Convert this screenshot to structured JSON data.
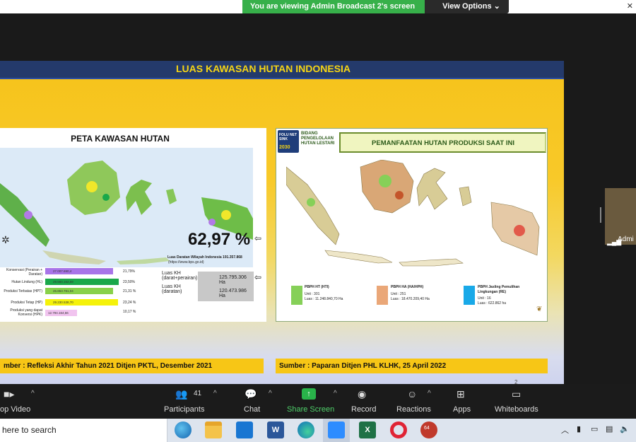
{
  "zoom_banner": {
    "viewing_text": "You are viewing Admin Broadcast 2's screen",
    "view_options_label": "View Options"
  },
  "slide": {
    "title": "LUAS KAWASAN HUTAN INDONESIA",
    "page_number": "2",
    "left_panel": {
      "map_title": "PETA KAWASAN HUTAN",
      "percentage": "62,97 %",
      "land_area_note": "Luas Daratan Wilayah Indonesia 191.357.868",
      "land_area_source": "(https://www.bps.go.id)",
      "legend": [
        {
          "label": "Konservasi (Perairan + Daratan)",
          "value": "27.007.690,4",
          "pct": "21,79%",
          "color": "#a874e8",
          "fill": 0.78
        },
        {
          "label": "Hutan Lindung (HL)",
          "value": "29.560.152,59",
          "pct": "23,50%",
          "color": "#1aa84a",
          "fill": 0.85
        },
        {
          "label": "Produksi Terbatas (HPT)",
          "value": "26.863.781,04",
          "pct": "21,31 %",
          "color": "#89d14a",
          "fill": 0.78
        },
        {
          "label": "Produksi Tetap (HP)",
          "value": "29.230.538,70",
          "pct": "23,24 %",
          "color": "#f5f20a",
          "fill": 0.84
        },
        {
          "label": "Produksi yang dapat Konversi (HPK)",
          "value": "12.794.164,66",
          "pct": "10,17 %",
          "color": "#f1c4ef",
          "fill": 0.37
        }
      ],
      "kh_rows": [
        {
          "label": "Luas KH (darat+perairan)",
          "value": "125.795.306 Ha"
        },
        {
          "label": "Luas KH (daratan)",
          "value": "120.473.986 Ha"
        }
      ],
      "source": "mber : Refleksi Akhir Tahun 2021 Ditjen PKTL, Desember 2021"
    },
    "right_panel": {
      "folu_line1": "FOLU NET SINK",
      "folu_year": "2030",
      "folu_line2": "BIDANG PENGELOLAAN HUTAN LESTARI",
      "header": "PEMANFAATAN HUTAN PRODUKSI SAAT INI",
      "legend": [
        {
          "title": "PBPH HT (HTI)",
          "unit": "Unit : 301",
          "luas": "Luas : 11.248.840,70 Ha",
          "color": "#86d058"
        },
        {
          "title": "PBPH HA (HA/HPH)",
          "unit": "Unit : 251",
          "luas": "Luas : 18.470.209,40 Ha",
          "color": "#eaa778"
        },
        {
          "title": "PBPH Jasling Pemulihan Lingkungan (RE)",
          "unit": "Unit : 16",
          "luas": "Luas : 622.862 ha",
          "color": "#19a9e8"
        }
      ],
      "source": "Sumber : Paparan Ditjen PHL KLHK, 25 April 2022"
    }
  },
  "participant": {
    "name": "Admi"
  },
  "toolbar": {
    "video_label": "op Video",
    "participants_label": "Participants",
    "participants_count": "41",
    "chat_label": "Chat",
    "share_label": "Share Screen",
    "record_label": "Record",
    "reactions_label": "Reactions",
    "apps_label": "Apps",
    "whiteboards_label": "Whiteboards"
  },
  "taskbar": {
    "search_placeholder": "here to search",
    "badge": "64"
  }
}
